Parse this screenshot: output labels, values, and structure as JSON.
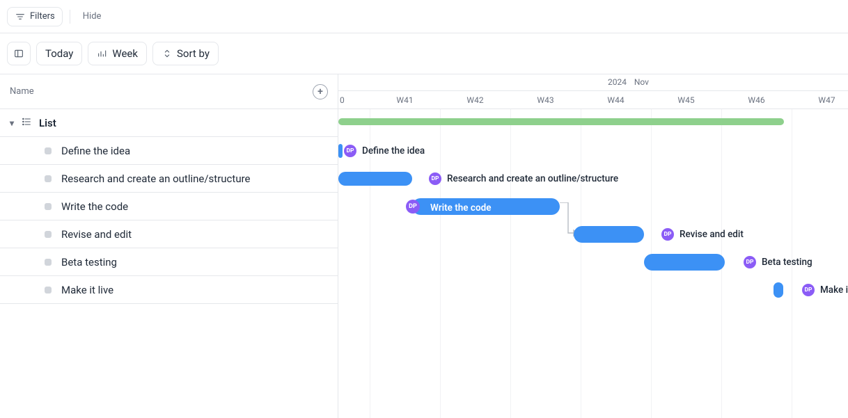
{
  "filterbar": {
    "filters_label": "Filters",
    "hide_label": "Hide"
  },
  "toolbar": {
    "today": "Today",
    "week": "Week",
    "sortby": "Sort by"
  },
  "sidebar": {
    "column_label": "Name",
    "group": {
      "label": "List"
    },
    "tasks": [
      {
        "label": "Define the idea"
      },
      {
        "label": "Research and create an outline/structure"
      },
      {
        "label": "Write the code"
      },
      {
        "label": "Revise and edit"
      },
      {
        "label": "Beta testing"
      },
      {
        "label": "Make it live"
      }
    ]
  },
  "timeline": {
    "year": "2024",
    "month": "Nov",
    "weeks": [
      "0",
      "W41",
      "W42",
      "W43",
      "W44",
      "W45",
      "W46",
      "W47"
    ],
    "assignee_initials": "DP",
    "tasks": [
      {
        "label": "Define the idea",
        "start_week": 40.0,
        "duration_weeks": 0.1
      },
      {
        "label": "Research and create an outline/structure",
        "start_week": 39.6,
        "duration_weeks": 1.05
      },
      {
        "label": "Write the code",
        "start_week": 40.6,
        "duration_weeks": 2.1
      },
      {
        "label": "Revise and edit",
        "start_week": 43.0,
        "duration_weeks": 1.0
      },
      {
        "label": "Beta testing",
        "start_week": 44.0,
        "duration_weeks": 1.15
      },
      {
        "label": "Make it live",
        "start_week": 45.8,
        "duration_weeks": 0.15
      }
    ],
    "summary": {
      "start_week": 39.6,
      "end_week": 45.95
    }
  }
}
